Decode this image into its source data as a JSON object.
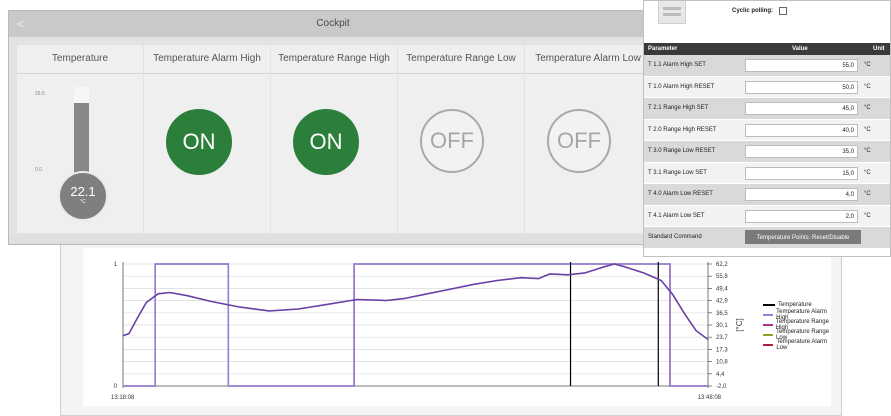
{
  "cockpit": {
    "title": "Cockpit",
    "back_glyph": "<",
    "tiles": [
      {
        "label": "Temperature",
        "kind": "thermometer"
      },
      {
        "label": "Temperature Alarm High",
        "state": "ON"
      },
      {
        "label": "Temperature Range High",
        "state": "ON"
      },
      {
        "label": "Temperature Range Low",
        "state": "OFF"
      },
      {
        "label": "Temperature Alarm Low",
        "state": "OFF"
      }
    ],
    "thermometer": {
      "value": "22.1",
      "unit": "°C",
      "scale_top": "26.5",
      "scale_bottom": "0.0",
      "fill_fraction": 0.85
    }
  },
  "param_panel": {
    "cyclic_label": "Cyclic polling:",
    "cyclic_checked": false,
    "headers": {
      "parameter": "Parameter",
      "value": "Value",
      "unit": "Unit"
    },
    "rows": [
      {
        "name": "T 1.1 Alarm High SET",
        "value": "55,0",
        "unit": "°C"
      },
      {
        "name": "T 1.0 Alarm High RESET",
        "value": "50,0",
        "unit": "°C"
      },
      {
        "name": "T 2.1 Range High SET",
        "value": "45,0",
        "unit": "°C"
      },
      {
        "name": "T 2.0 Range High RESET",
        "value": "40,0",
        "unit": "°C"
      },
      {
        "name": "T 3.0 Range Low RESET",
        "value": "35,0",
        "unit": "°C"
      },
      {
        "name": "T 3.1 Range Low SET",
        "value": "15,0",
        "unit": "°C"
      },
      {
        "name": "T 4.0 Alarm Low RESET",
        "value": "4,0",
        "unit": "°C"
      },
      {
        "name": "T 4.1 Alarm Low SET",
        "value": "2,0",
        "unit": "°C"
      }
    ],
    "std_command_label": "Standard Command",
    "std_command_button": "Temperature Points: Reset/Disable"
  },
  "chart_data": {
    "type": "line",
    "x_start_label": "13:18:08",
    "x_end_label": "13:48:08",
    "left_ticks": [
      "1",
      "0"
    ],
    "right_ticks": [
      "62,2",
      "55,8",
      "49,4",
      "42,9",
      "36,5",
      "30,1",
      "23,7",
      "17,3",
      "10,8",
      "4,4",
      "-2,0"
    ],
    "right_axis_label": "[°C]",
    "ylim": [
      -2.0,
      62.2
    ],
    "legend": [
      {
        "name": "Temperature",
        "color": "#000000"
      },
      {
        "name": "Temperature Alarm High",
        "color": "#8e86d6"
      },
      {
        "name": "Temperature Range High",
        "color": "#b0308a"
      },
      {
        "name": "Temperature Range Low",
        "color": "#8aa326"
      },
      {
        "name": "Temperature Alarm Low",
        "color": "#b21d3a"
      }
    ],
    "temperature_curve": [
      [
        0,
        24.5
      ],
      [
        0.01,
        25.5
      ],
      [
        0.025,
        34
      ],
      [
        0.04,
        42
      ],
      [
        0.06,
        46.5
      ],
      [
        0.08,
        47.2
      ],
      [
        0.11,
        45.5
      ],
      [
        0.15,
        42.5
      ],
      [
        0.2,
        39.5
      ],
      [
        0.25,
        37.5
      ],
      [
        0.3,
        38.5
      ],
      [
        0.35,
        41
      ],
      [
        0.4,
        43.5
      ],
      [
        0.45,
        43
      ],
      [
        0.48,
        44
      ],
      [
        0.52,
        46.5
      ],
      [
        0.56,
        49
      ],
      [
        0.6,
        51.5
      ],
      [
        0.64,
        53.5
      ],
      [
        0.68,
        55
      ],
      [
        0.71,
        54.5
      ],
      [
        0.73,
        57
      ],
      [
        0.76,
        56.5
      ],
      [
        0.79,
        57.5
      ],
      [
        0.82,
        60.5
      ],
      [
        0.84,
        62.2
      ],
      [
        0.86,
        60.5
      ],
      [
        0.89,
        57.5
      ],
      [
        0.92,
        53.5
      ],
      [
        0.94,
        46
      ],
      [
        0.96,
        36
      ],
      [
        0.98,
        27
      ],
      [
        1.0,
        22.5
      ]
    ],
    "alarm_high_steps": [
      [
        0,
        0
      ],
      [
        0.055,
        0
      ],
      [
        0.055,
        1
      ],
      [
        0.18,
        1
      ],
      [
        0.18,
        0
      ],
      [
        0.395,
        0
      ],
      [
        0.395,
        1
      ],
      [
        0.935,
        1
      ],
      [
        0.935,
        0
      ],
      [
        1,
        0
      ]
    ],
    "range_high_steps": [
      [
        0,
        0
      ],
      [
        0.055,
        0
      ],
      [
        0.055,
        1
      ],
      [
        0.18,
        1
      ],
      [
        0.18,
        0
      ],
      [
        0.395,
        0
      ],
      [
        0.395,
        1
      ],
      [
        0.935,
        1
      ],
      [
        0.935,
        0
      ],
      [
        1,
        0
      ]
    ],
    "temperature_marks": [
      0.765,
      0.915
    ]
  }
}
